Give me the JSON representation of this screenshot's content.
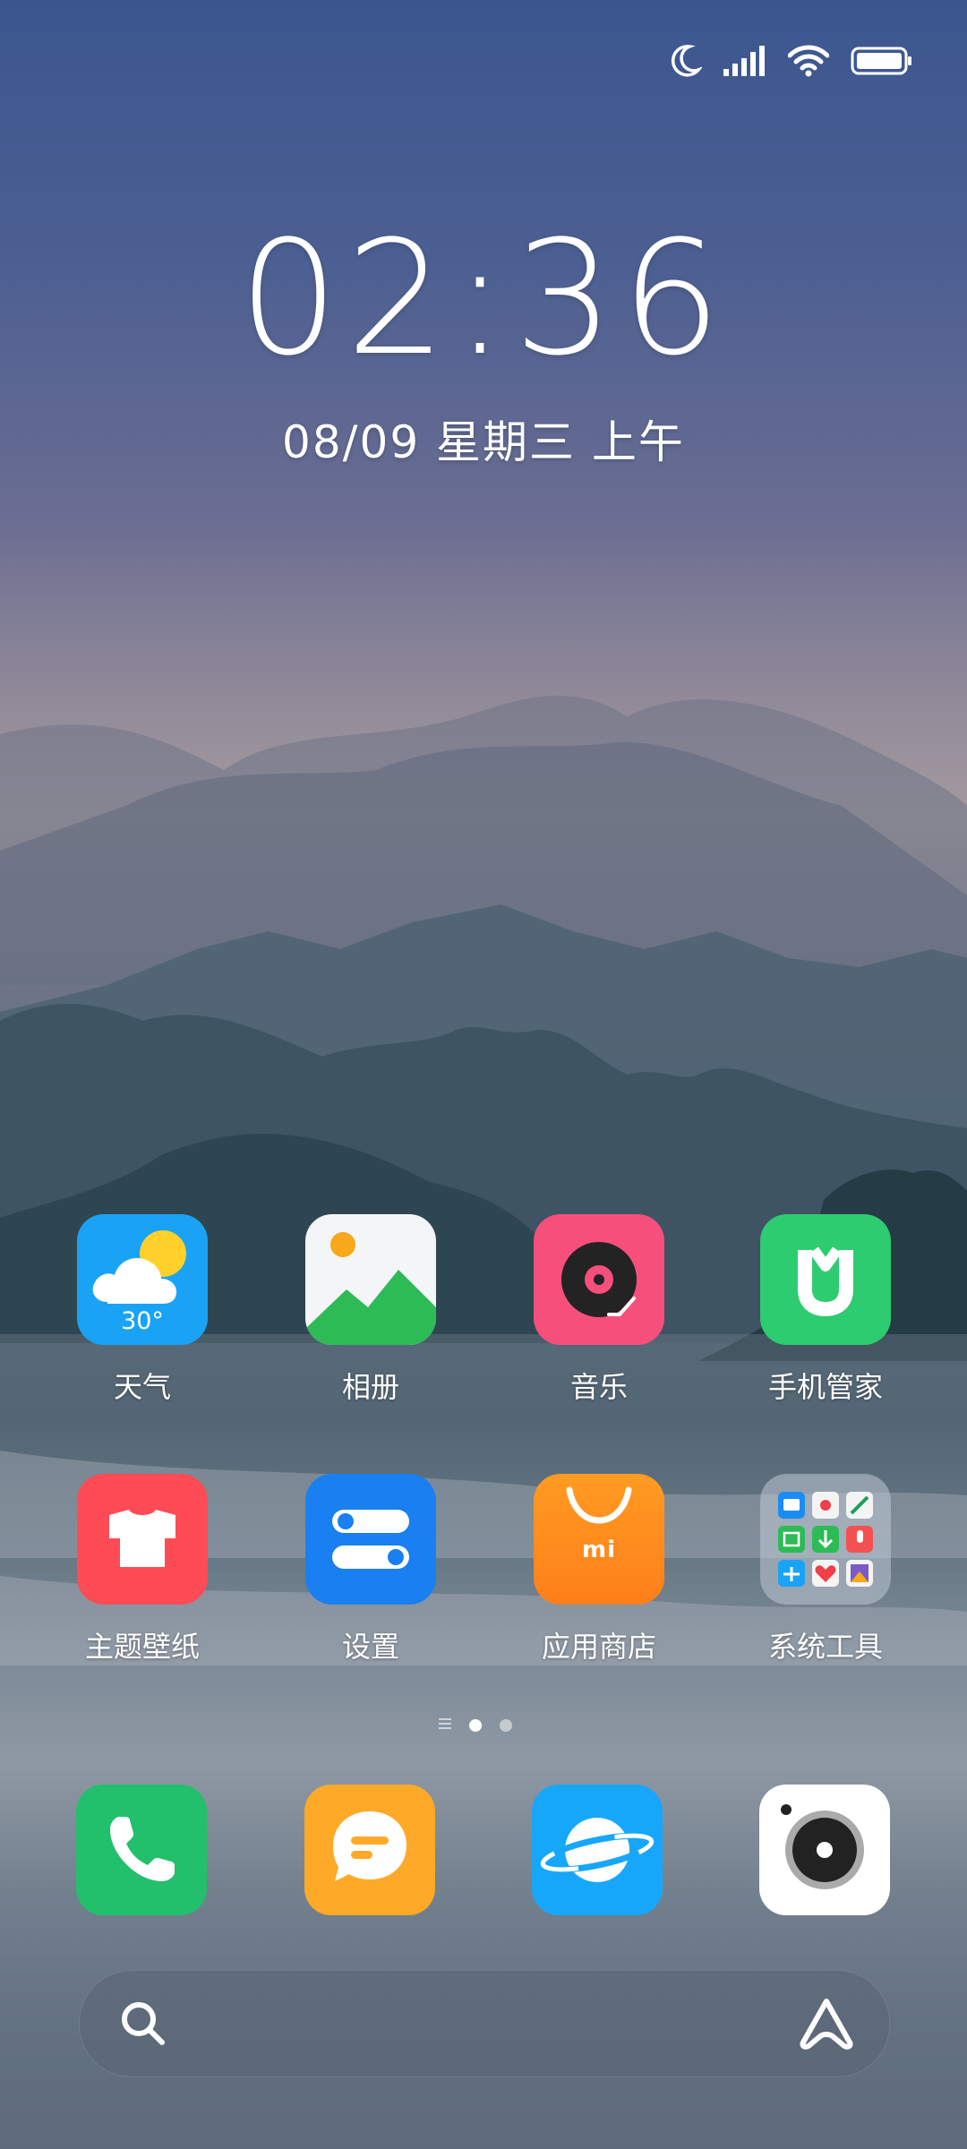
{
  "status_bar": {
    "icons": [
      "moon-icon",
      "signal-icon",
      "wifi-icon",
      "battery-icon"
    ]
  },
  "clock": {
    "time": "02:36",
    "date": "08/09 星期三 上午"
  },
  "home_grid": [
    {
      "label": "天气",
      "icon": "weather-icon",
      "badge": "30°"
    },
    {
      "label": "相册",
      "icon": "gallery-icon"
    },
    {
      "label": "音乐",
      "icon": "music-icon"
    },
    {
      "label": "手机管家",
      "icon": "security-icon"
    },
    {
      "label": "主题壁纸",
      "icon": "themes-icon"
    },
    {
      "label": "设置",
      "icon": "settings-icon"
    },
    {
      "label": "应用商店",
      "icon": "app-store-icon",
      "badge": "mi"
    },
    {
      "label": "系统工具",
      "icon": "folder-icon"
    }
  ],
  "page_indicator": {
    "pages": 3,
    "current": 1
  },
  "dock": [
    {
      "icon": "phone-icon"
    },
    {
      "icon": "messages-icon"
    },
    {
      "icon": "browser-icon"
    },
    {
      "icon": "camera-icon"
    }
  ],
  "search": {
    "left_icon": "search-icon",
    "right_icon": "assistant-icon"
  },
  "colors": {
    "weather": "#1aa3f5",
    "music": "#f74f7c",
    "security": "#2ecc71",
    "themes": "#ff4b55",
    "settings": "#1a7ff0",
    "app_store": "#ff8a1d",
    "phone": "#22c06c",
    "messages": "#ffa928",
    "browser": "#17a7fa"
  }
}
